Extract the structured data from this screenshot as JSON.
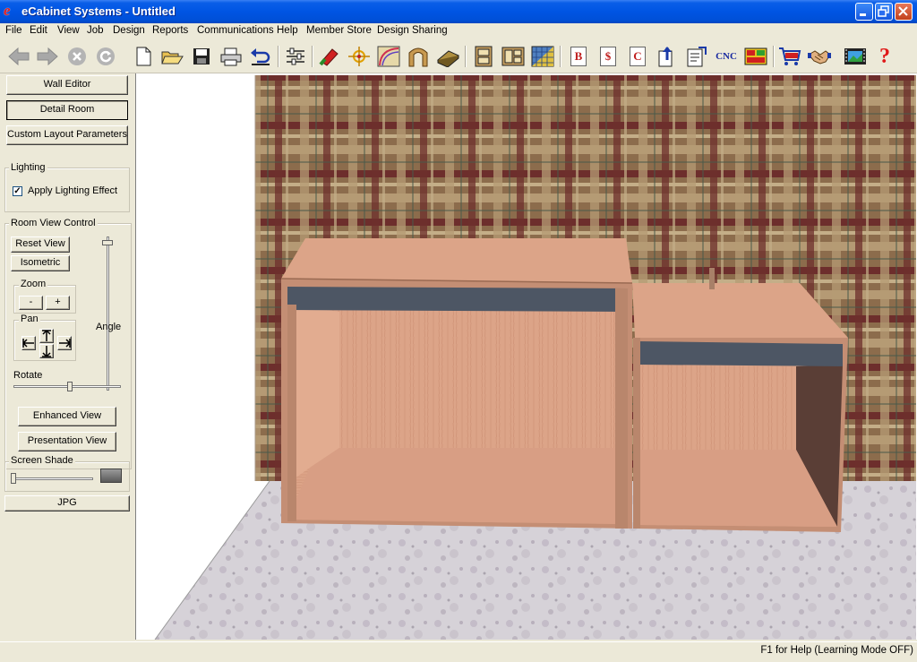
{
  "window": {
    "title": "eCabinet Systems - Untitled",
    "app_icon": "e"
  },
  "menu": [
    "File",
    "Edit",
    "View",
    "Job",
    "Design",
    "Reports",
    "Communications",
    "Help",
    "Member Store",
    "Design Sharing"
  ],
  "toolbar": {
    "icons": [
      "back-arrow-icon",
      "forward-arrow-icon",
      "stop-icon",
      "refresh-icon",
      "new-file-icon",
      "open-folder-icon",
      "save-disk-icon",
      "print-icon",
      "undo-icon",
      "settings-sliders-icon",
      "hardware-icon",
      "node-icon",
      "curve-icon",
      "arch-icon",
      "board-icon",
      "cabinet-icon",
      "cabinet-list-icon",
      "texture-icon",
      "bill-icon",
      "cost-icon",
      "cutlist-icon",
      "export-icon",
      "report-icon",
      "cnc-icon",
      "panel-layout-icon",
      "cart-icon",
      "handshake-icon",
      "film-icon",
      "help-icon"
    ],
    "letters": {
      "bill": "B",
      "cost": "$",
      "cutlist": "C",
      "cnc": "CNC",
      "help": "?"
    }
  },
  "panel": {
    "wall_editor": "Wall Editor",
    "detail_room": "Detail Room",
    "custom_layout": "Custom Layout Parameters",
    "lighting_title": "Lighting",
    "apply_lighting": "Apply Lighting Effect",
    "apply_lighting_checked": true,
    "check_mark": "✓",
    "room_view_title": "Room View Control",
    "reset_view": "Reset View",
    "isometric": "Isometric",
    "zoom_title": "Zoom",
    "zoom_out": "-",
    "zoom_in": "+",
    "pan_title": "Pan",
    "angle_label": "Angle",
    "rotate_label": "Rotate",
    "enhanced_view": "Enhanced View",
    "presentation_view": "Presentation View",
    "screen_shade_title": "Screen Shade",
    "jpg": "JPG"
  },
  "status": {
    "help_text": "F1 for Help (Learning Mode OFF)"
  },
  "colors": {
    "titlebar": "#0054e3",
    "wood": "#dca488",
    "wood_dark": "#b9866c",
    "shelf_rail": "#4a5462",
    "plaid_base": "#8a6a4a",
    "floor": "#d8d4d8"
  }
}
